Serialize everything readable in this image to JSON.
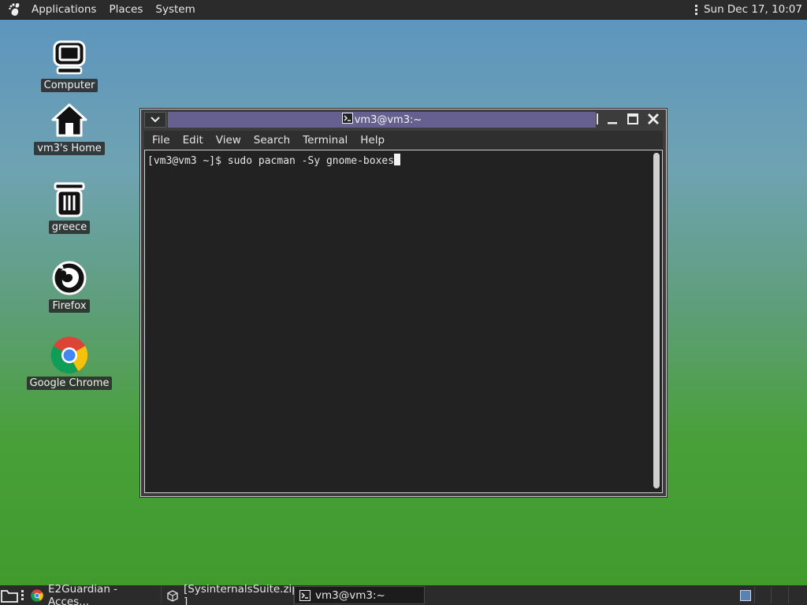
{
  "top_panel": {
    "menus": [
      "Applications",
      "Places",
      "System"
    ],
    "clock": "Sun Dec 17, 10:07"
  },
  "desktop_icons": [
    {
      "label": "Computer",
      "icon": "computer-icon"
    },
    {
      "label": "vm3's Home",
      "icon": "home-icon"
    },
    {
      "label": "greece",
      "icon": "trash-icon"
    },
    {
      "label": "Firefox",
      "icon": "firefox-icon"
    },
    {
      "label": "Google Chrome",
      "icon": "chrome-icon"
    }
  ],
  "terminal": {
    "title": "vm3@vm3:~",
    "menu": [
      "File",
      "Edit",
      "View",
      "Search",
      "Terminal",
      "Help"
    ],
    "prompt": "[vm3@vm3 ~]$ ",
    "command": "sudo pacman -Sy gnome-boxes"
  },
  "taskbar": {
    "tasks": [
      {
        "label": "E2Guardian - Acces...",
        "icon": "chrome-icon"
      },
      {
        "label": "[SysinternalsSuite.zip ]",
        "icon": "archive-icon"
      },
      {
        "label": "vm3@vm3:~",
        "icon": "terminal-icon"
      }
    ]
  }
}
